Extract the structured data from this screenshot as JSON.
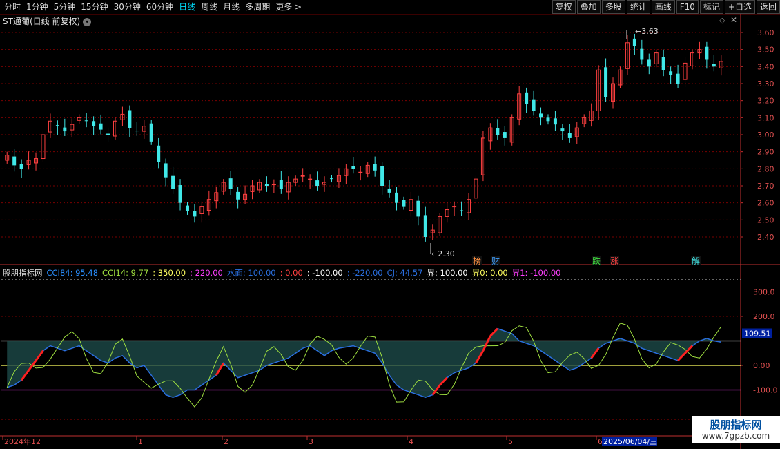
{
  "toolbar": {
    "periods": [
      "分时",
      "1分钟",
      "5分钟",
      "15分钟",
      "30分钟",
      "60分钟",
      "日线",
      "周线",
      "月线",
      "多周期",
      "更多 >"
    ],
    "active_period": "日线",
    "buttons": [
      "复权",
      "叠加",
      "多股",
      "统计",
      "画线",
      "F10",
      "标记",
      "+自选",
      "返回"
    ]
  },
  "stock": {
    "title": "ST通葡(日线 前复权)"
  },
  "colors": {
    "up": "#ff4040",
    "down": "#40e8e8",
    "grid": "#7a0000",
    "axis": "#c03030",
    "yellow": "#ffff60",
    "magenta": "#ff40ff",
    "white": "#ffffff",
    "cci84": "#2a6fe0",
    "cci14": "#a0e040"
  },
  "price_axis": {
    "ticks": [
      "3.60",
      "3.50",
      "3.40",
      "3.30",
      "3.20",
      "3.10",
      "3.00",
      "2.90",
      "2.80",
      "2.70",
      "2.60",
      "2.50",
      "2.40"
    ],
    "min": 2.3,
    "max": 3.63
  },
  "annotations": {
    "high": "3.63",
    "low": "2.30"
  },
  "event_tags": [
    "榜",
    "财",
    "跌",
    "涨",
    "解"
  ],
  "indicator": {
    "name": "股朋指标网",
    "items": [
      {
        "text": "CCI84: 95.48",
        "color": "#2a8fff"
      },
      {
        "text": "CCI14: 9.77",
        "color": "#a0e040"
      },
      {
        "text": ": 350.00",
        "color": "#ffff60"
      },
      {
        "text": ": 220.00",
        "color": "#ff40ff"
      },
      {
        "text": "水面: 100.00",
        "color": "#2a6fe0"
      },
      {
        "text": ": 0.00",
        "color": "#ff4040"
      },
      {
        "text": ": -100.00",
        "color": "#ffffff"
      },
      {
        "text": ": -220.00",
        "color": "#2a6fe0"
      },
      {
        "text": "CJ: 44.57",
        "color": "#2a6fe0"
      },
      {
        "text": "界: 100.00",
        "color": "#ffffff"
      },
      {
        "text": "界0: 0.00",
        "color": "#ffff60"
      },
      {
        "text": "界1: -100.00",
        "color": "#ff40ff"
      }
    ],
    "axis_ticks": [
      "300.0",
      "200.0",
      "109.51",
      "0.00",
      "-100.0"
    ],
    "current_label": "109.51"
  },
  "time_axis": {
    "labels": [
      "2024年12",
      "1",
      "2",
      "3",
      "4",
      "5",
      "6"
    ],
    "cursor_date": "2025/06/04/三"
  },
  "watermark": {
    "title": "股朋指标网",
    "url": "www.7gpzb.com"
  },
  "chart_data": {
    "type": "candlestick",
    "title": "ST通葡(日线 前复权)",
    "ylim": [
      2.3,
      3.63
    ],
    "close_series": [
      2.88,
      2.82,
      2.8,
      2.85,
      2.86,
      3.0,
      3.08,
      3.05,
      3.02,
      3.06,
      3.1,
      3.08,
      3.05,
      3.03,
      3.0,
      3.08,
      3.12,
      3.04,
      3.02,
      3.05,
      2.96,
      2.84,
      2.75,
      2.68,
      2.6,
      2.55,
      2.52,
      2.58,
      2.62,
      2.66,
      2.72,
      2.68,
      2.62,
      2.65,
      2.7,
      2.72,
      2.7,
      2.71,
      2.68,
      2.72,
      2.74,
      2.76,
      2.74,
      2.7,
      2.72,
      2.74,
      2.76,
      2.8,
      2.8,
      2.78,
      2.82,
      2.79,
      2.7,
      2.66,
      2.6,
      2.58,
      2.62,
      2.52,
      2.4,
      2.44,
      2.52,
      2.56,
      2.58,
      2.55,
      2.62,
      2.74,
      2.98,
      3.04,
      3.0,
      2.98,
      3.1,
      3.24,
      3.18,
      3.14,
      3.1,
      3.08,
      3.06,
      3.02,
      2.98,
      3.04,
      3.1,
      3.14,
      3.38,
      3.22,
      3.3,
      3.38,
      3.54,
      3.52,
      3.44,
      3.4,
      3.48,
      3.38,
      3.35,
      3.3,
      3.42,
      3.48,
      3.5,
      3.44,
      3.4,
      3.43
    ],
    "cci84": [
      -90,
      -80,
      -60,
      -20,
      20,
      60,
      80,
      70,
      60,
      70,
      80,
      60,
      40,
      20,
      10,
      30,
      40,
      10,
      -10,
      0,
      -40,
      -80,
      -120,
      -130,
      -120,
      -100,
      -100,
      -80,
      -60,
      -40,
      10,
      -20,
      -50,
      -40,
      -30,
      -20,
      0,
      10,
      20,
      30,
      50,
      70,
      80,
      60,
      40,
      60,
      70,
      75,
      80,
      70,
      60,
      50,
      10,
      -40,
      -80,
      -100,
      -110,
      -120,
      -130,
      -120,
      -80,
      -50,
      -30,
      -20,
      -10,
      10,
      60,
      120,
      150,
      140,
      130,
      100,
      90,
      80,
      60,
      40,
      20,
      0,
      -20,
      -10,
      10,
      30,
      70,
      90,
      100,
      110,
      100,
      90,
      70,
      60,
      50,
      40,
      30,
      20,
      50,
      80,
      100,
      110,
      100,
      95
    ]
  }
}
